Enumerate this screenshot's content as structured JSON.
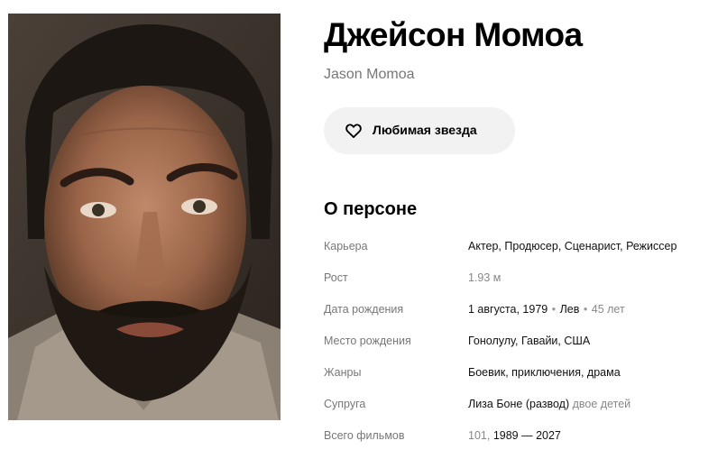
{
  "person": {
    "name_ru": "Джейсон Момоа",
    "name_en": "Jason Momoa"
  },
  "favorite_button": {
    "label": "Любимая звезда",
    "icon": "heart-icon"
  },
  "about": {
    "title": "О персоне",
    "career": {
      "label": "Карьера",
      "value": "Актер, Продюсер, Сценарист, Режиссер"
    },
    "height": {
      "label": "Рост",
      "value": "1.93 м"
    },
    "birth_date": {
      "label": "Дата рождения",
      "date": "1 августа, 1979",
      "separator": "•",
      "zodiac": "Лев",
      "age": "45 лет"
    },
    "birth_place": {
      "label": "Место рождения",
      "value": "Гонолулу, Гавайи, США"
    },
    "genres": {
      "label": "Жанры",
      "value": "Боевик, приключения, драма"
    },
    "spouse": {
      "label": "Супруга",
      "value": "Лиза Боне (развод)",
      "note": "двое детей"
    },
    "total_films": {
      "label": "Всего фильмов",
      "count": "101,",
      "years": "1989 — 2027"
    }
  },
  "colors": {
    "button_bg": "#f2f2f2",
    "muted_text": "#777777",
    "text": "#000000"
  }
}
